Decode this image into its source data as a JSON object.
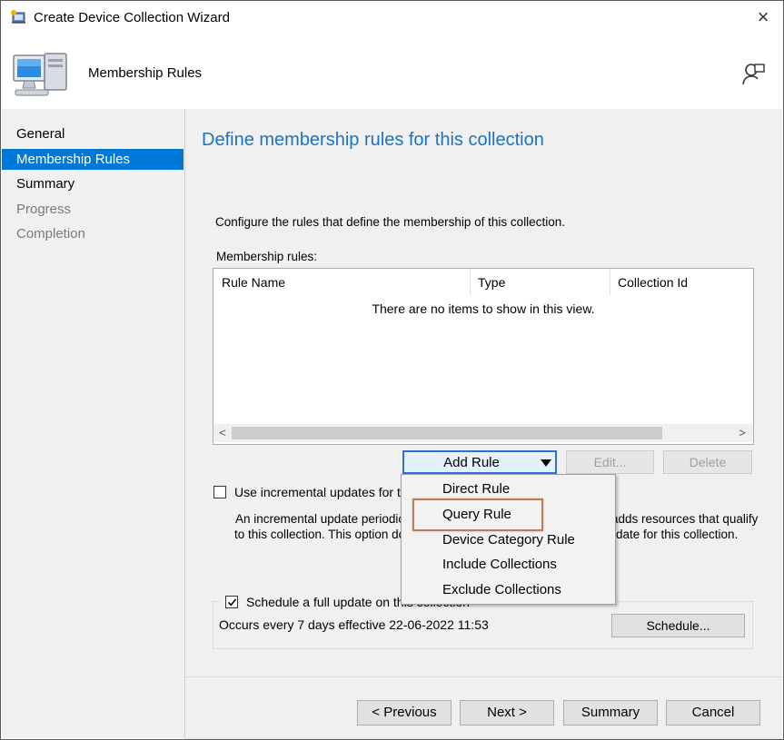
{
  "window": {
    "title": "Create Device Collection Wizard",
    "close_icon": "×"
  },
  "header": {
    "title": "Membership Rules"
  },
  "nav": {
    "items": [
      {
        "label": "General",
        "state": "normal"
      },
      {
        "label": "Membership Rules",
        "state": "selected"
      },
      {
        "label": "Summary",
        "state": "normal"
      },
      {
        "label": "Progress",
        "state": "disabled"
      },
      {
        "label": "Completion",
        "state": "disabled"
      }
    ]
  },
  "content": {
    "heading": "Define membership rules for this collection",
    "description": "Configure the rules that define the membership of this collection.",
    "rules_label": "Membership rules:",
    "columns": [
      "Rule Name",
      "Type",
      "Collection Id"
    ],
    "empty_text": "There are no items to show in this view.",
    "scroll_left": "<",
    "scroll_right": ">",
    "add_rule": "Add Rule",
    "edit": "Edit...",
    "delete": "Delete",
    "incremental_label": "Use incremental updates for thi",
    "incremental_checked": false,
    "incremental_desc_line1_left": "An incremental update periodic",
    "incremental_desc_line1_right": "adds resources that qualify",
    "incremental_desc_line2_left": "to this collection. This option do",
    "incremental_desc_line2_right": "date for this collection.",
    "schedule_label": "Schedule a full update on this collection",
    "schedule_checked": true,
    "schedule_info": "Occurs every 7 days effective 22-06-2022 11:53",
    "schedule_button": "Schedule..."
  },
  "menu": {
    "items": [
      "Direct Rule",
      "Query Rule",
      "Device Category Rule",
      "Include Collections",
      "Exclude Collections"
    ],
    "highlighted": "Query Rule",
    "highlight_color": "#b87d5a"
  },
  "footer": {
    "previous": "< Previous",
    "next": "Next >",
    "summary": "Summary",
    "cancel": "Cancel"
  },
  "colors": {
    "accent": "#0078d7",
    "heading": "#1e73be"
  }
}
